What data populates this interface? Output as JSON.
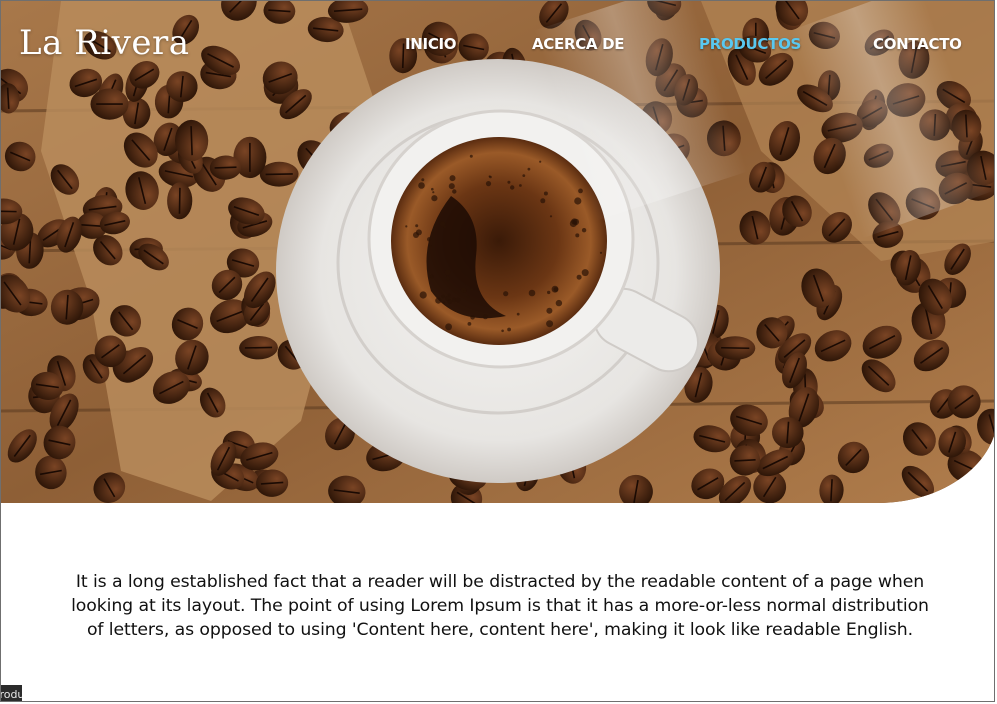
{
  "brand": {
    "logo_text": "La Rivera"
  },
  "nav": {
    "items": [
      {
        "label": "INICIO",
        "active": false
      },
      {
        "label": "ACERCA DE",
        "active": false
      },
      {
        "label": "PRODUCTOS",
        "active": true
      },
      {
        "label": "CONTACTO",
        "active": false
      }
    ]
  },
  "hero": {
    "image": "coffee-cup-with-beans",
    "colors": {
      "wood": "#9a6a3e",
      "burlap": "#b98c5c",
      "saucer": "#e8e6e4",
      "coffee": "#6b3614",
      "bean": "#4a2410"
    }
  },
  "content": {
    "paragraph": "It is a long established fact that a reader will be distracted by the readable content of a page when looking at its layout. The point of using Lorem Ipsum is that it has a more-or-less normal distribution of letters, as opposed to using 'Content here, content here', making it look like readable English."
  },
  "status_tooltip": {
    "text": "Productos"
  },
  "colors": {
    "nav_active": "#59c8f0",
    "nav_text": "#ffffff",
    "body_text": "#111111"
  }
}
